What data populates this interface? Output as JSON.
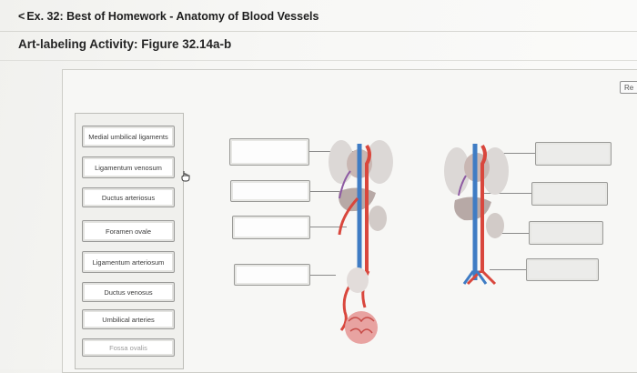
{
  "header": {
    "back_chevron": "<",
    "back_text": "Ex. 32: Best of Homework - Anatomy of Blood Vessels"
  },
  "activity": {
    "title": "Art-labeling Activity: Figure 32.14a-b",
    "reset_label": "Re"
  },
  "labels": [
    "Medial umbilical ligaments",
    "Ligamentum venosum",
    "Ductus arteriosus",
    "Foramen ovale",
    "Ligamentum arteriosum",
    "Ductus venosus",
    "Umbilical arteries",
    "Fossa ovalis"
  ],
  "figures": [
    "fetal-circulation-figure",
    "adult-circulation-figure"
  ],
  "icons": {
    "cursor": "hand-pointer-icon"
  },
  "colors": {
    "artery": "#d9473d",
    "vein": "#3f7cc4",
    "organ": "#d8d3d0",
    "placenta": "#e8a3a1"
  }
}
